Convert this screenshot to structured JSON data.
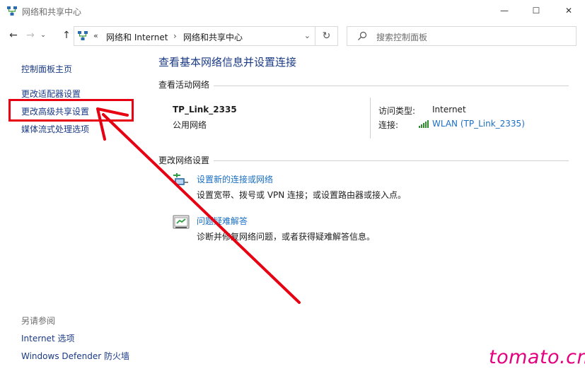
{
  "window": {
    "title": "网络和共享中心",
    "minimize_glyph": "—",
    "maximize_glyph": "☐",
    "close_glyph": "✕"
  },
  "navigation": {
    "back_glyph": "←",
    "forward_glyph": "→",
    "recent_glyph": "⌄",
    "up_glyph": "↑",
    "address_prefix": "«",
    "breadcrumbs": [
      "网络和 Internet",
      "网络和共享中心"
    ],
    "breadcrumb_separator": "›",
    "dropdown_glyph": "⌄",
    "refresh_glyph": "↻",
    "search_placeholder": "搜索控制面板"
  },
  "sidebar": {
    "items": [
      {
        "label": "控制面板主页"
      },
      {
        "label": "更改适配器设置"
      },
      {
        "label": "更改高级共享设置"
      },
      {
        "label": "媒体流式处理选项"
      }
    ],
    "see_also_title": "另请参阅",
    "see_also": [
      {
        "label": "Internet 选项"
      },
      {
        "label": "Windows Defender 防火墙"
      }
    ]
  },
  "main": {
    "title": "查看基本网络信息并设置连接",
    "active_networks": {
      "heading": "查看活动网络",
      "network_name": "TP_Link_2335",
      "network_category": "公用网络",
      "access_type_label": "访问类型:",
      "access_type_value": "Internet",
      "connection_label": "连接:",
      "connection_value": "WLAN (TP_Link_2335)"
    },
    "change_settings": {
      "heading": "更改网络设置",
      "tasks": [
        {
          "link": "设置新的连接或网络",
          "description": "设置宽带、拨号或 VPN 连接；或设置路由器或接入点。",
          "icon": "new-connection-icon"
        },
        {
          "link": "问题疑难解答",
          "description": "诊断并修复网络问题，或者获得疑难解答信息。",
          "icon": "troubleshoot-icon"
        }
      ]
    }
  },
  "annotation": {
    "highlight_color": "#e60012"
  },
  "watermark": "tomato.cm",
  "colors": {
    "link": "#1a6fc4",
    "sidebar_link": "#1a3a86",
    "watermark": "#e4007f"
  }
}
